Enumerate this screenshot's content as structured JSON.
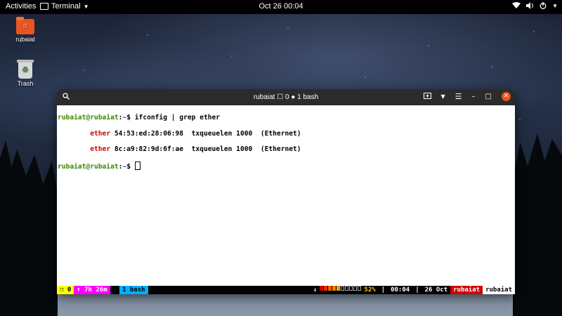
{
  "topbar": {
    "activities": "Activities",
    "app_name": "Terminal",
    "clock": "Oct 26  00:04",
    "icons": [
      "wifi-icon",
      "volume-icon",
      "power-icon",
      "chevron-down-icon"
    ]
  },
  "desktop": {
    "home_label": "rubaiat",
    "trash_label": "Trash"
  },
  "window": {
    "title": "rubaiat ☐ 0 ● 1 bash"
  },
  "terminal": {
    "prompt_user": "rubaiat@rubaiat",
    "prompt_sep": ":",
    "prompt_dir": "~",
    "prompt_char": "$ ",
    "command": "ifconfig | grep ether",
    "lines": [
      {
        "key": "ether",
        "rest": " 54:53:ed:28:06:98  txqueuelen 1000  (Ethernet)"
      },
      {
        "key": "ether",
        "rest": " 8c:a9:82:9d:6f:ae  txqueuelen 1000  (Ethernet)"
      }
    ]
  },
  "status": {
    "session": "❐ 0",
    "uptime": "↑ 7h 26m",
    "window": "1 bash",
    "arrow": "↓",
    "battery_level": 0.52,
    "battery": "52%",
    "time": "00:04",
    "date": "26 Oct",
    "user": "rubaiat",
    "host": "rubaiat"
  },
  "colors": {
    "accent": "#e95420",
    "prompt_green": "#3a8a00",
    "prompt_blue": "#2c4ad8",
    "grep_match": "#d00000"
  }
}
